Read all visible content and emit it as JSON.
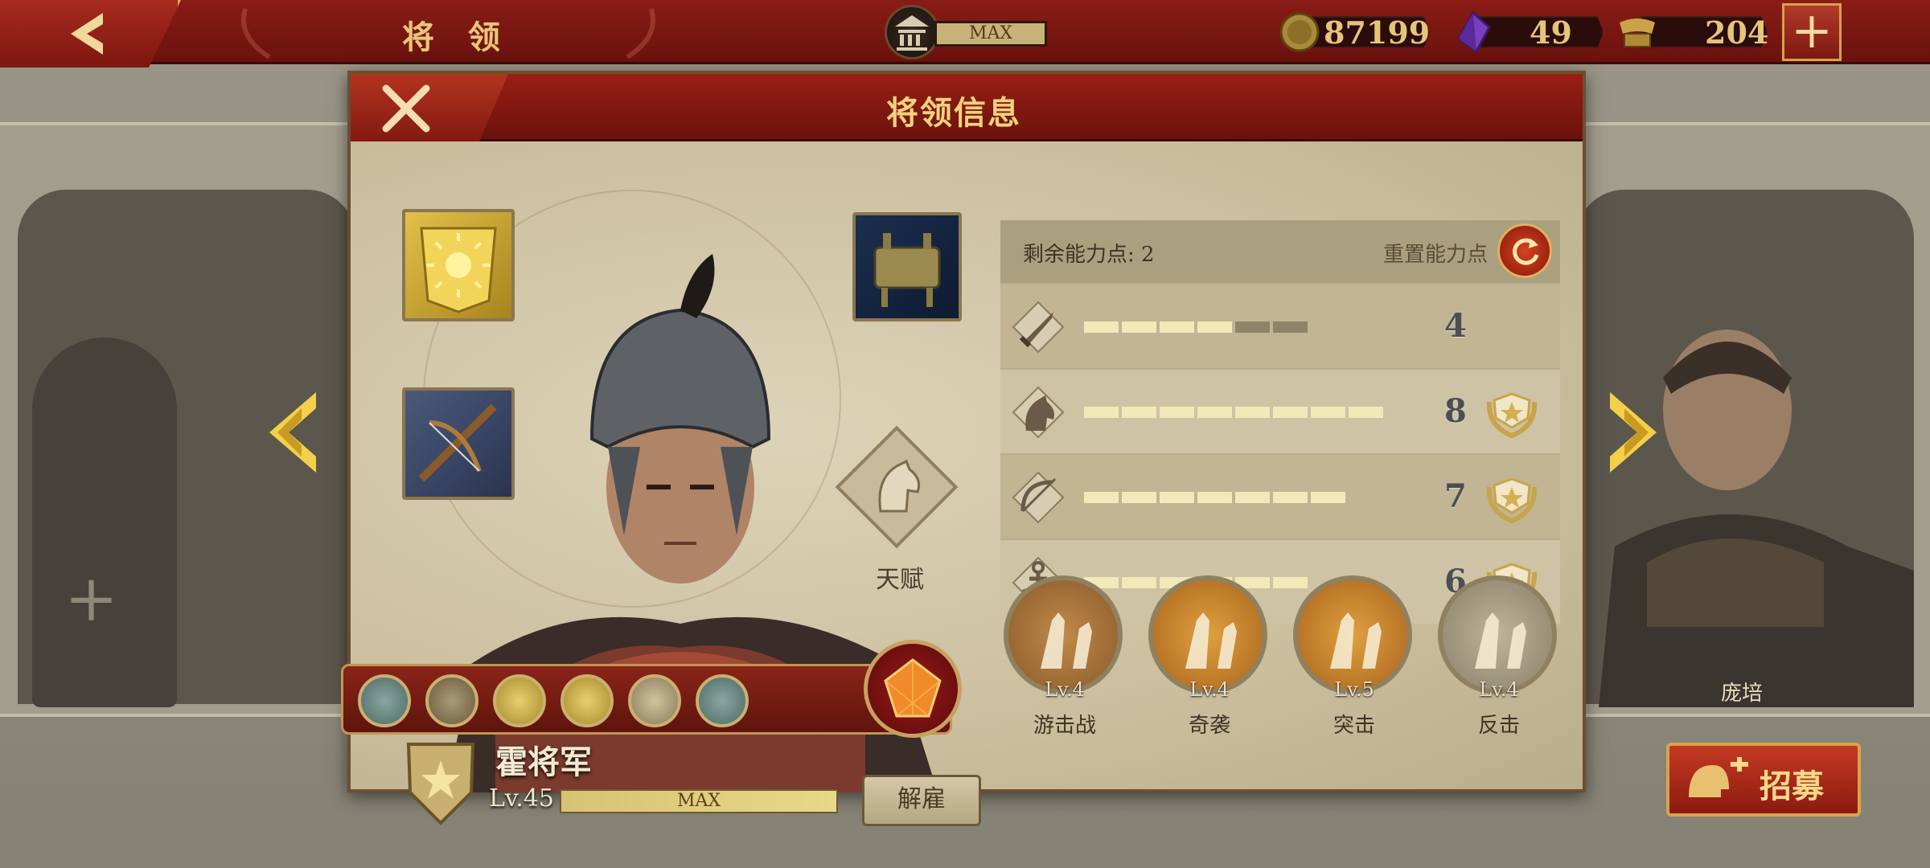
{
  "topbar": {
    "title": "将 领",
    "building_level": "MAX",
    "gold": "87199",
    "gems": "49",
    "spqr": "204"
  },
  "dialog": {
    "title": "将领信息",
    "talent_label": "天赋",
    "hero_name": "霍将军",
    "hero_level": "Lv.45",
    "exp_text": "MAX",
    "dismiss_label": "解雇"
  },
  "stats": {
    "remaining_label": "剩余能力点: 2",
    "reset_label": "重置能力点",
    "rows": [
      {
        "icon": "sword-icon",
        "value": "4",
        "filled": 4,
        "total": 6,
        "medal": false
      },
      {
        "icon": "horse-icon",
        "value": "8",
        "filled": 8,
        "total": 8,
        "medal": true
      },
      {
        "icon": "bow-icon",
        "value": "7",
        "filled": 7,
        "total": 7,
        "medal": true
      },
      {
        "icon": "anchor-icon",
        "value": "6",
        "filled": 6,
        "total": 6,
        "medal": true
      }
    ]
  },
  "tactics": [
    {
      "level": "Lv.4",
      "name": "游击战",
      "tone": "bronze"
    },
    {
      "level": "Lv.4",
      "name": "奇袭",
      "tone": "gold"
    },
    {
      "level": "Lv.5",
      "name": "突击",
      "tone": "gold"
    },
    {
      "level": "Lv.4",
      "name": "反击",
      "tone": "grey"
    }
  ],
  "background": {
    "right_hero_name": "庞培",
    "recruit_label": "招募"
  },
  "colors": {
    "banner_red": "#7a1610",
    "gold_text": "#f2d27e",
    "parchment": "#d3c8ad"
  }
}
